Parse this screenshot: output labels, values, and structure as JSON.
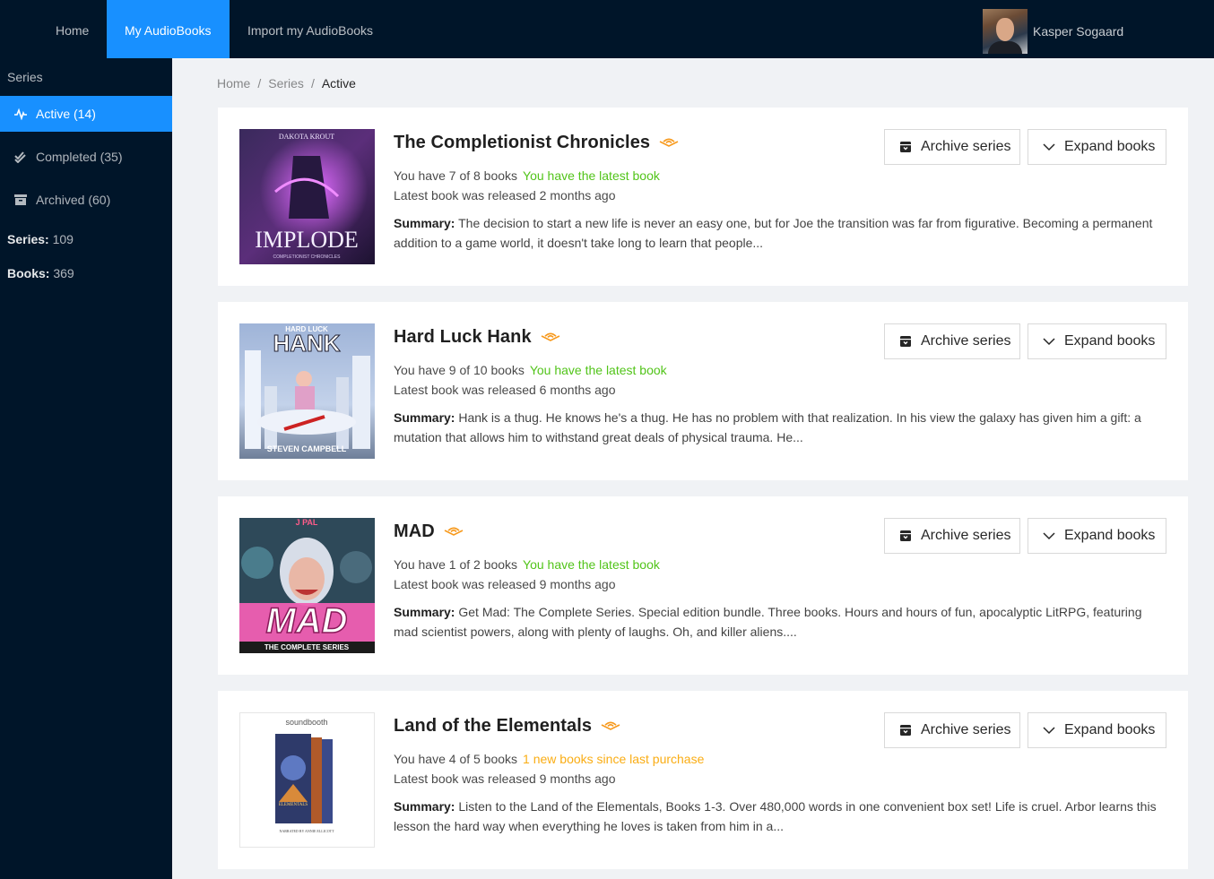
{
  "nav": {
    "items": [
      {
        "label": "Home"
      },
      {
        "label": "My AudioBooks"
      },
      {
        "label": "Import my AudioBooks"
      }
    ],
    "user_name": "Kasper Sogaard"
  },
  "sidebar": {
    "heading": "Series",
    "items": [
      {
        "label": "Active (14)",
        "icon": "activity-icon"
      },
      {
        "label": "Completed (35)",
        "icon": "double-check-icon"
      },
      {
        "label": "Archived (60)",
        "icon": "archive-box-icon"
      }
    ],
    "stats": {
      "series_label": "Series:",
      "series_value": " 109",
      "books_label": "Books:",
      "books_value": " 369"
    }
  },
  "breadcrumb": {
    "items": [
      "Home",
      "Series",
      "Active"
    ],
    "separator": "/"
  },
  "buttons": {
    "archive_label": "Archive series",
    "expand_label": "Expand books"
  },
  "summary_label": "Summary:",
  "colors": {
    "nav_bg": "#001529",
    "accent": "#1890ff",
    "status_latest": "#52c41a",
    "status_new": "#faad14",
    "audible_orange": "#f7991c"
  },
  "series": [
    {
      "title": "The Completionist Chronicles",
      "books_owned": "You have 7 of 8 books",
      "status": "You have the latest book",
      "status_type": "latest",
      "released": "Latest book was released 2 months ago",
      "summary": "The decision to start a new life is never an easy one, but for Joe the transition was far from figurative. Becoming a permanent addition to a game world, it doesn't take long to learn that people...",
      "cover": {
        "top": "DAKOTA KROUT",
        "big": "IMPLODE",
        "sub": "COMPLETIONIST CHRONICLES"
      }
    },
    {
      "title": "Hard Luck Hank",
      "books_owned": "You have 9 of 10 books",
      "status": "You have the latest book",
      "status_type": "latest",
      "released": "Latest book was released 6 months ago",
      "summary": "Hank is a thug. He knows he's a thug. He has no problem with that realization. In his view the galaxy has given him a gift: a mutation that allows him to withstand great deals of physical trauma. He...",
      "cover": {
        "top": "HARD LUCK",
        "big": "HANK",
        "sub": "STEVEN CAMPBELL"
      }
    },
    {
      "title": "MAD",
      "books_owned": "You have 1 of 2 books",
      "status": "You have the latest book",
      "status_type": "latest",
      "released": "Latest book was released 9 months ago",
      "summary": "Get Mad: The Complete Series. Special edition bundle. Three books. Hours and hours of fun, apocalyptic LitRPG, featuring mad scientist powers, along with plenty of laughs. Oh, and killer aliens....",
      "cover": {
        "top": "J PAL",
        "big": "MAD",
        "sub": "THE COMPLETE SERIES"
      }
    },
    {
      "title": "Land of the Elementals",
      "books_owned": "You have 4 of 5 books",
      "status": "1 new books since last purchase",
      "status_type": "new",
      "released": "Latest book was released 9 months ago",
      "summary": "Listen to the Land of the Elementals, Books 1-3. Over 480,000 words in one convenient box set! Life is cruel. Arbor learns this lesson the hard way when everything he loves is taken from him in a...",
      "cover": {
        "top": "soundbooth",
        "big": "ELEMENTALS",
        "sub": "NARRATED BY ANNIE ELLICOTT"
      }
    }
  ]
}
